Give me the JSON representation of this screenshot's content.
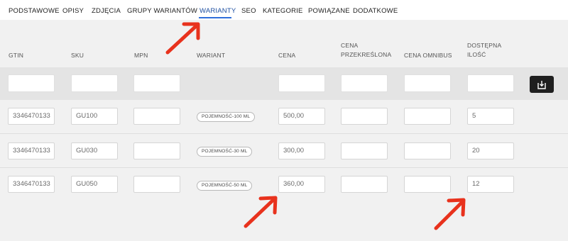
{
  "tabs": [
    {
      "label": "PODSTAWOWE"
    },
    {
      "label": "OPISY"
    },
    {
      "label": "ZDJĘCIA"
    },
    {
      "label": "GRUPY WARIANTÓW"
    },
    {
      "label": "WARIANTY",
      "active": true
    },
    {
      "label": "SEO"
    },
    {
      "label": "KATEGORIE"
    },
    {
      "label": "POWIĄZANE"
    },
    {
      "label": "DODATKOWE"
    }
  ],
  "columns": {
    "gtin": "GTIN",
    "sku": "SKU",
    "mpn": "MPN",
    "variant": "WARIANT",
    "price": "CENA",
    "strike_price_l1": "CENA",
    "strike_price_l2": "PRZEKREŚLONA",
    "omnibus": "CENA OMNIBUS",
    "qty_l1": "DOSTĘPNA",
    "qty_l2": "ILOŚĆ"
  },
  "rows": [
    {
      "gtin": "3346470133",
      "sku": "GU100",
      "mpn": "",
      "variant": "POJEMNOŚĆ-100 ML",
      "price": "500,00",
      "strike_price": "",
      "omnibus": "",
      "qty": "5"
    },
    {
      "gtin": "3346470133",
      "sku": "GU030",
      "mpn": "",
      "variant": "POJEMNOŚĆ-30 ML",
      "price": "300,00",
      "strike_price": "",
      "omnibus": "",
      "qty": "20"
    },
    {
      "gtin": "3346470133",
      "sku": "GU050",
      "mpn": "",
      "variant": "POJEMNOŚĆ-50 ML",
      "price": "360,00",
      "strike_price": "",
      "omnibus": "",
      "qty": "12"
    }
  ],
  "icons": {
    "save": "save-icon",
    "annotation_arrow": "red-arrow-icon"
  },
  "colors": {
    "active_tab_underline": "#2f6fdb",
    "annotation_arrow": "#e8321d",
    "save_button": "#1f1f1f"
  }
}
